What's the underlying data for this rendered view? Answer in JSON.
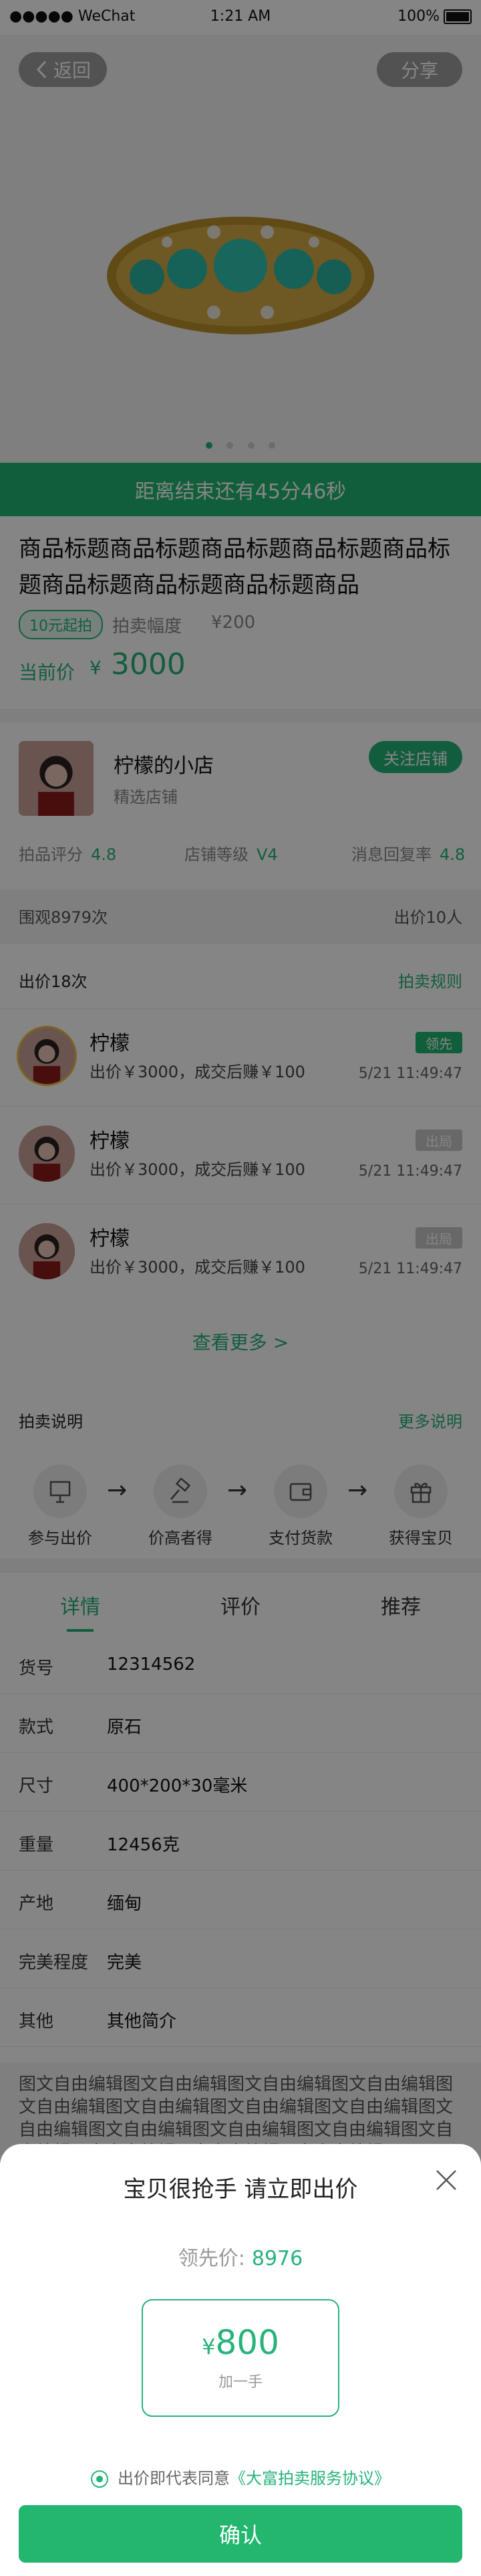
{
  "status": {
    "carrier": "●●●●● WeChat",
    "time": "1:21 AM",
    "battery": "100%"
  },
  "nav": {
    "back": "返回",
    "share": "分享"
  },
  "countdown": "距离结束还有45分46秒",
  "product": {
    "title": "商品标题商品标题商品标题商品标题商品标题商品标题商品标题商品标题商品",
    "tag": "10元起拍",
    "step_label": "拍卖幅度",
    "step_value": "¥200",
    "price_label": "当前价",
    "price_currency": "¥",
    "price": "3000"
  },
  "shop": {
    "name": "柠檬的小店",
    "subtitle": "精选店铺",
    "follow": "关注店铺",
    "stats": [
      {
        "label": "拍品评分",
        "value": "4.8"
      },
      {
        "label": "店铺等级",
        "value": "V4"
      },
      {
        "label": "消息回复率",
        "value": "4.8"
      }
    ]
  },
  "meta": {
    "views": "围观8979次",
    "bidders": "出价10人"
  },
  "bids": {
    "header": "出价18次",
    "rules_link": "拍卖规则",
    "rows": [
      {
        "name": "柠檬",
        "desc": "出价￥3000，成交后赚￥100",
        "badge": "领先",
        "time": "5/21 11:49:47"
      },
      {
        "name": "柠檬",
        "desc": "出价￥3000，成交后赚￥100",
        "badge": "出局",
        "time": "5/21 11:49:47"
      },
      {
        "name": "柠檬",
        "desc": "出价￥3000，成交后赚￥100",
        "badge": "出局",
        "time": "5/21 11:49:47"
      }
    ],
    "more": "查看更多 >"
  },
  "rules": {
    "title": "拍卖说明",
    "more": "更多说明",
    "steps": [
      "参与出价",
      "价高者得",
      "支付货款",
      "获得宝贝"
    ]
  },
  "tabs": [
    "详情",
    "评价",
    "推荐"
  ],
  "specs": [
    {
      "k": "货号",
      "v": "12314562"
    },
    {
      "k": "款式",
      "v": "原石"
    },
    {
      "k": "尺寸",
      "v": "400*200*30毫米"
    },
    {
      "k": "重量",
      "v": "12456克"
    },
    {
      "k": "产地",
      "v": "缅甸"
    },
    {
      "k": "完美程度",
      "v": "完美"
    },
    {
      "k": "其他",
      "v": "其他简介"
    }
  ],
  "freetext": "图文自由编辑图文自由编辑图文自由编辑图文自由编辑图文自由编辑图文自由编辑图文自由编辑图文自由编辑图文自由编辑图文自由编辑图文自由编辑图文自由编辑图文自由编辑图文自由编辑图文自由编辑图文自由编辑",
  "sheet": {
    "title": "宝贝很抢手 请立即出价",
    "lead_label": "领先价:",
    "lead_value": "8976",
    "inc_currency": "¥",
    "inc_value": "800",
    "inc_label": "加一手",
    "agree_prefix": "出价即代表同意",
    "agree_link": "《大富拍卖服务协议》",
    "confirm": "确认"
  },
  "colors": {
    "accent": "#26b37a",
    "lead_badge": "#22b66f",
    "out_badge": "#c7c7c7"
  }
}
